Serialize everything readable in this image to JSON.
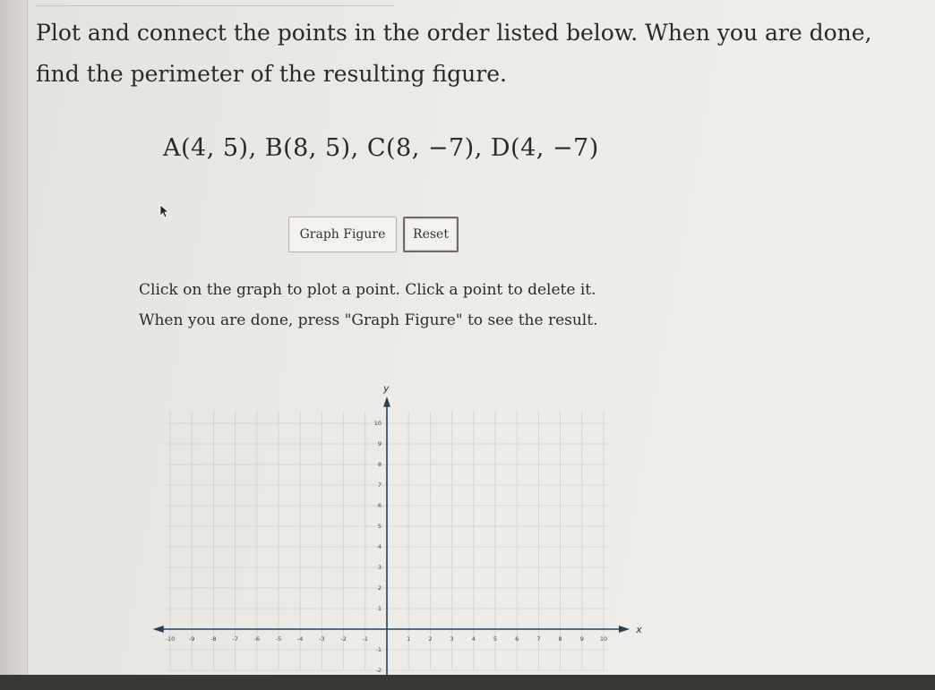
{
  "problem": {
    "instruction": "Plot and connect the points in the order listed below. When you are done, find the perimeter of the resulting figure.",
    "points_text": "A(4, 5), B(8, 5), C(8, −7), D(4, −7)"
  },
  "buttons": {
    "graph_figure": "Graph Figure",
    "reset": "Reset"
  },
  "hints": {
    "line1": "Click on the graph to plot a point. Click a point to delete it.",
    "line2": "When you are done, press \"Graph Figure\" to see the result."
  },
  "chart_data": {
    "type": "scatter",
    "xlabel": "x",
    "ylabel": "y",
    "xlim": [
      -10,
      10
    ],
    "ylim": [
      -2,
      10
    ],
    "x_ticks": [
      "-10",
      "-9",
      "-8",
      "-7",
      "-6",
      "-5",
      "-4",
      "-3",
      "-2",
      "-1",
      "1",
      "2",
      "3",
      "4",
      "5",
      "6",
      "7",
      "8",
      "9",
      "10"
    ],
    "y_ticks": [
      "10",
      "9",
      "8",
      "7",
      "6",
      "5",
      "4",
      "3",
      "2",
      "1",
      "-1",
      "-2"
    ],
    "grid": true,
    "points": []
  }
}
